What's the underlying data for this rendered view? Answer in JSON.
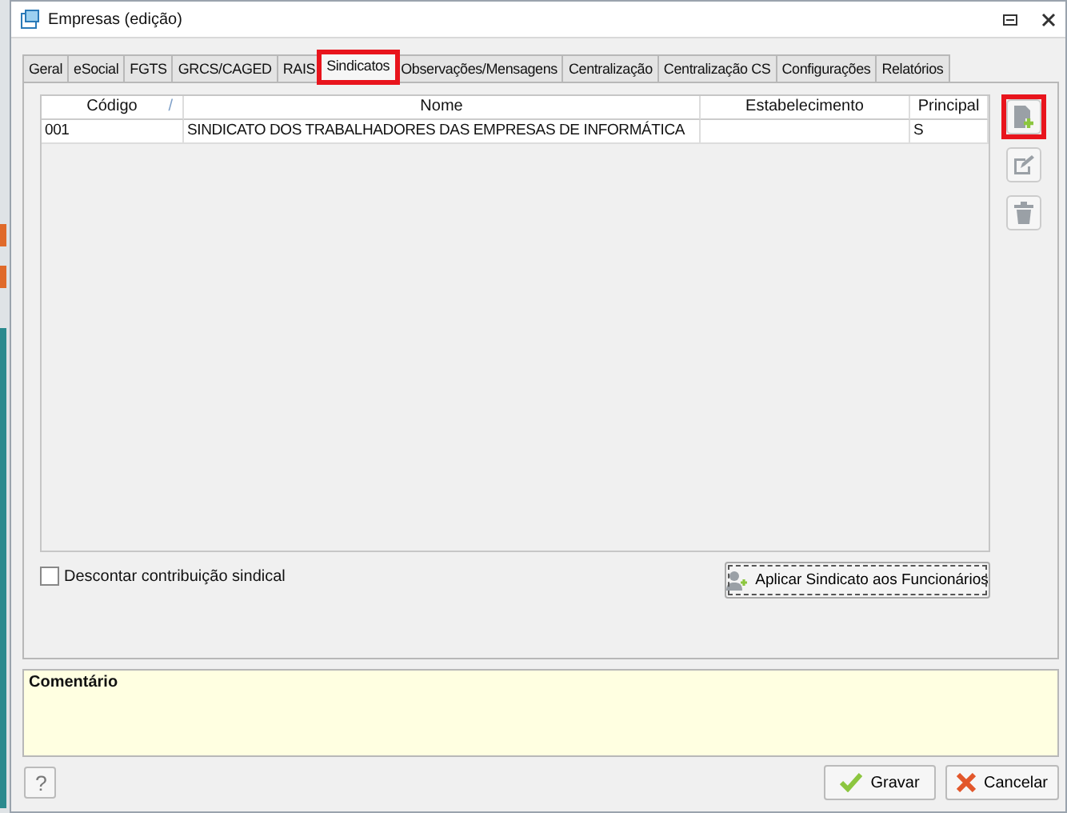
{
  "window": {
    "title": "Empresas (edição)"
  },
  "tabs": [
    {
      "label": "Geral",
      "selected": false,
      "highlighted": false
    },
    {
      "label": "eSocial",
      "selected": false,
      "highlighted": false
    },
    {
      "label": "FGTS",
      "selected": false,
      "highlighted": false
    },
    {
      "label": "GRCS/CAGED",
      "selected": false,
      "highlighted": false
    },
    {
      "label": "RAIS",
      "selected": false,
      "highlighted": false
    },
    {
      "label": "Sindicatos",
      "selected": true,
      "highlighted": true
    },
    {
      "label": "Observações/Mensagens",
      "selected": false,
      "highlighted": false
    },
    {
      "label": "Centralização",
      "selected": false,
      "highlighted": false
    },
    {
      "label": "Centralização CS",
      "selected": false,
      "highlighted": false
    },
    {
      "label": "Configurações",
      "selected": false,
      "highlighted": false
    },
    {
      "label": "Relatórios",
      "selected": false,
      "highlighted": false
    }
  ],
  "table": {
    "columns": [
      {
        "label": "Código",
        "sort": "/"
      },
      {
        "label": "Nome"
      },
      {
        "label": "Estabelecimento"
      },
      {
        "label": "Principal"
      }
    ],
    "rows": [
      [
        "001",
        "SINDICATO DOS TRABALHADORES DAS EMPRESAS DE INFORMÁTICA",
        "",
        "S"
      ]
    ]
  },
  "side_buttons": [
    {
      "kind": "add",
      "highlighted": true
    },
    {
      "kind": "edit",
      "highlighted": false
    },
    {
      "kind": "delete",
      "highlighted": false
    }
  ],
  "discount_checkbox": {
    "label": "Descontar contribuição sindical",
    "checked": false
  },
  "apply_button": {
    "label": "Aplicar Sindicato aos Funcionários"
  },
  "comment": {
    "label": "Comentário"
  },
  "help_button": {
    "label": "?"
  },
  "buttons": [
    {
      "kind": "save",
      "label": "Gravar"
    },
    {
      "kind": "cancel",
      "label": "Cancelar"
    }
  ]
}
